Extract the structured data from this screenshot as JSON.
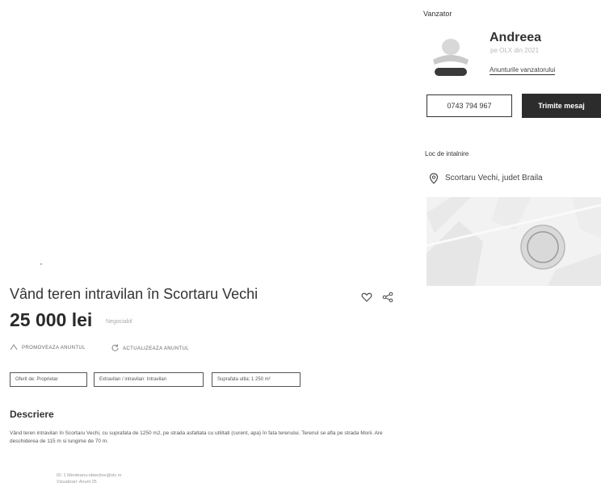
{
  "seller": {
    "heading": "Vanzator",
    "name": "Andreea",
    "since": "pe OLX din 2021",
    "all_ads_link": "Anunturile vanzatorului",
    "phone": "0743 794 967",
    "message_button": "Trimite mesaj"
  },
  "location": {
    "heading": "Loc de intalnire",
    "place": "Scortaru Vechi, judet Braila",
    "icon": "location-pin-icon"
  },
  "ad": {
    "title": "Vând teren intravilan în Scortaru Vechi",
    "price": "25 000 lei",
    "price_note": "Negociabil",
    "favorite_icon": "heart-icon",
    "share_icon": "share-icon"
  },
  "actions": {
    "promote": "PROMOVEAZA ANUNTUL",
    "refresh": "ACTUALIZEAZA ANUNTUL"
  },
  "tags": {
    "owner": "Oferit de: Proprietar",
    "land": "Extravilan / intravilan: Intravilan",
    "area": "Suprafata utila: 1 250 m²"
  },
  "description": {
    "heading": "Descriere",
    "body": "Vând teren intravilan în Scortaru Vechi, cu suprafata de 1250 m2, pe strada asfaltata cu utilitati (curent, apa) în fata terenului. Terenul se afla pe strada Morii. Are deschiderea de 115 m si lungime de 70 m.",
    "footer_line1": "ID: 1 Merdeanu-obiective@olx.ro",
    "footer_line2": "Vizualizari: Anunt 25"
  },
  "colors": {
    "dark_button": "#2c2c2c",
    "text": "#333333"
  }
}
